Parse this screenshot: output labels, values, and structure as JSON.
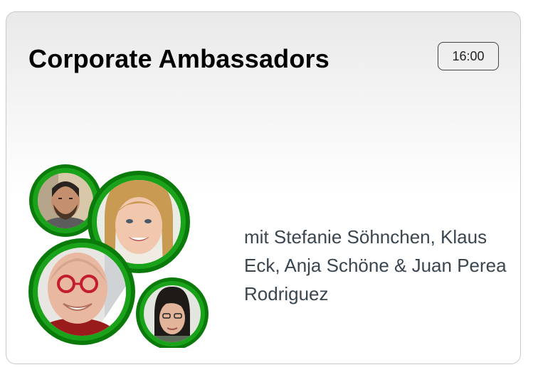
{
  "card": {
    "title": "Corporate Ambassadors",
    "time": "16:00",
    "speakers": "mit Stefanie Söhnchen, Klaus Eck, Anja Schöne & Juan Perea Rodriguez"
  },
  "colors": {
    "ring_green": "#179c17",
    "ring_green_dark": "#0a7a0a",
    "text_gray": "#3a4650"
  },
  "portraits": [
    "speaker-photo",
    "speaker-photo",
    "speaker-photo",
    "speaker-photo"
  ]
}
